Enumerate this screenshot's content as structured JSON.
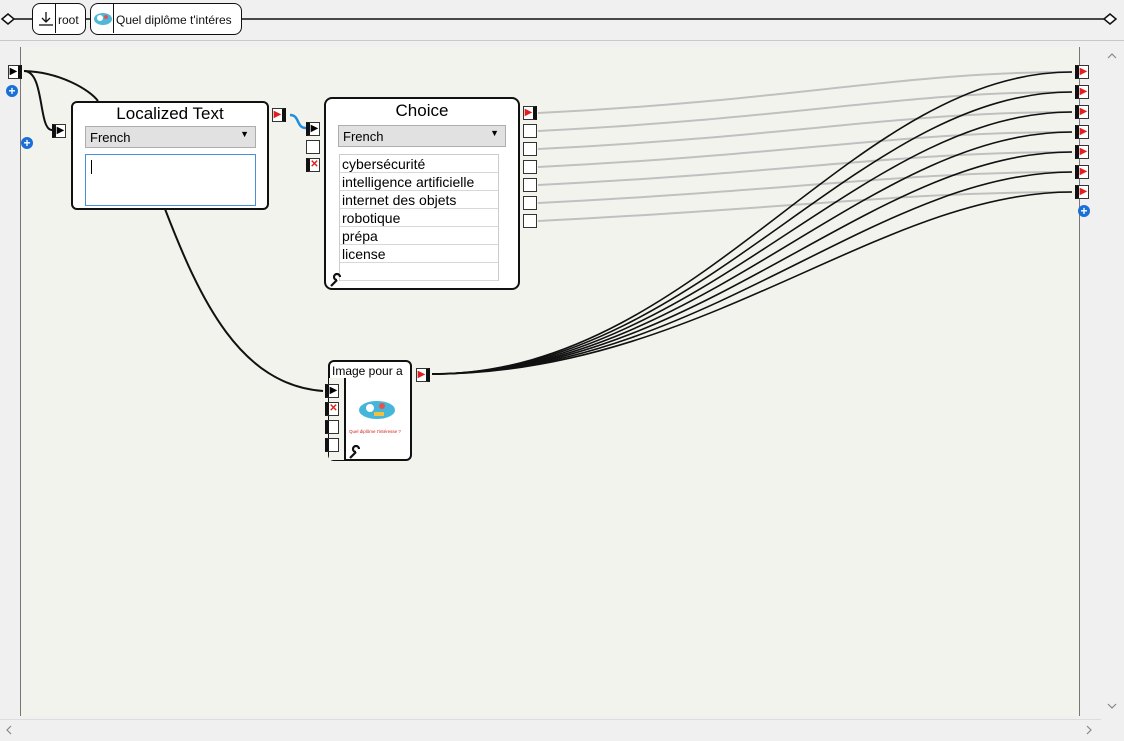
{
  "breadcrumb": {
    "root_label": "root",
    "behavior_label": "Quel diplôme t'intéres"
  },
  "localized_text": {
    "title": "Localized Text",
    "language": "French",
    "text_value": ""
  },
  "choice": {
    "title": "Choice",
    "language": "French",
    "answers": [
      "cybersécurité",
      "intelligence artificielle",
      "internet des objets",
      "robotique",
      "prépa",
      "license"
    ]
  },
  "image_box": {
    "title": "Image pour a",
    "thumbnail_caption": "Quel diplôme t'intéresse ?"
  },
  "icons": {
    "play": "▶",
    "stop": "✕",
    "plus": "+",
    "wrench": "wrench-icon",
    "dropdown": "▼"
  },
  "colors": {
    "link_black": "#111111",
    "link_grey": "#c0c0c0",
    "link_blue": "#1e8fe0",
    "stop_red": "#e02020",
    "plus_blue": "#1a6fd6",
    "canvas_bg": "#f3f3ee"
  }
}
